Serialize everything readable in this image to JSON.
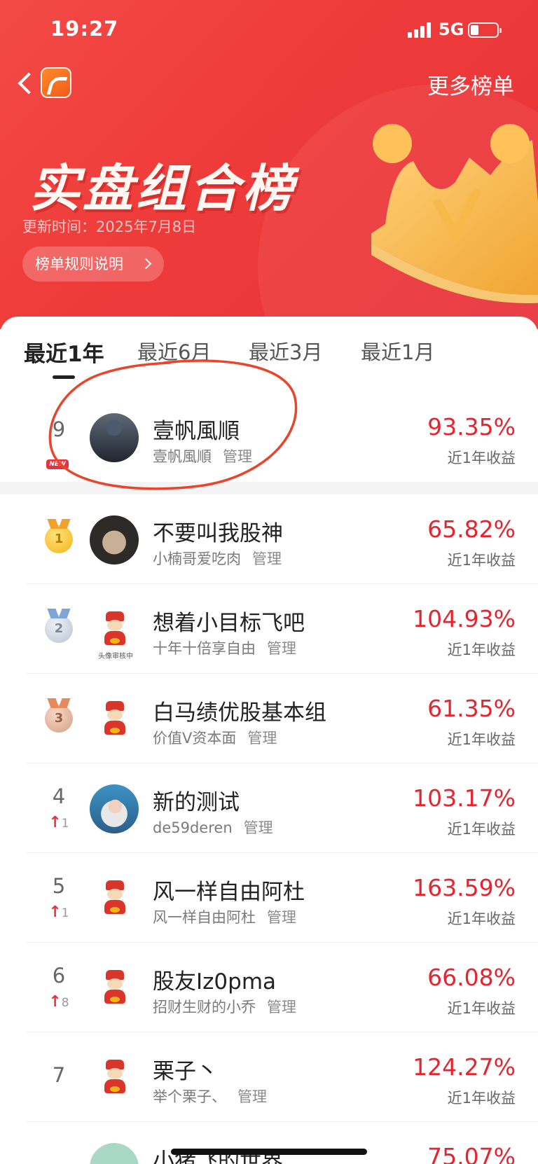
{
  "status": {
    "time": "19:27",
    "network": "5G",
    "battery_level": 0.3
  },
  "header": {
    "more_lists": "更多榜单"
  },
  "hero": {
    "title": "实盘组合榜",
    "update_time": "更新时间：2025年7月8日",
    "rules_button": "榜单规则说明"
  },
  "tabs": [
    {
      "label": "最近1年",
      "active": true
    },
    {
      "label": "最近6月",
      "active": false
    },
    {
      "label": "最近3月",
      "active": false
    },
    {
      "label": "最近1月",
      "active": false
    }
  ],
  "my_entry": {
    "rank": "9",
    "badge": "NEW",
    "name": "壹帆風順",
    "owner": "壹帆風順",
    "manage": "管理",
    "return": "93.35%",
    "return_label": "近1年收益"
  },
  "rankings": [
    {
      "medal": "gold",
      "rank": "1",
      "name": "不要叫我股神",
      "owner": "小楠哥爱吃肉",
      "manage": "管理",
      "return": "65.82%",
      "return_label": "近1年收益"
    },
    {
      "medal": "silver",
      "rank": "2",
      "name": "想着小目标飞吧",
      "owner": "十年十倍享自由",
      "manage": "管理",
      "return": "104.93%",
      "return_label": "近1年收益",
      "avatar_caption": "头像审核中"
    },
    {
      "medal": "bronze",
      "rank": "3",
      "name": "白马绩优股基本组",
      "owner": "价值V资本面",
      "manage": "管理",
      "return": "61.35%",
      "return_label": "近1年收益"
    },
    {
      "rank": "4",
      "change": "1",
      "name": "新的测试",
      "owner": "de59deren",
      "manage": "管理",
      "return": "103.17%",
      "return_label": "近1年收益"
    },
    {
      "rank": "5",
      "change": "1",
      "name": "风一样自由阿杜",
      "owner": "风一样自由阿杜",
      "manage": "管理",
      "return": "163.59%",
      "return_label": "近1年收益"
    },
    {
      "rank": "6",
      "change": "8",
      "name": "股友Iz0pma",
      "owner": "招财生财的小乔",
      "manage": "管理",
      "return": "66.08%",
      "return_label": "近1年收益"
    },
    {
      "rank": "7",
      "name": "栗子丶",
      "owner": "举个栗子、",
      "manage": "管理",
      "return": "124.27%",
      "return_label": "近1年收益"
    },
    {
      "name": "小猪飞的世界",
      "return": "75.07%"
    }
  ],
  "colors": {
    "hero_red": "#ee3b3a",
    "return_red": "#e8232f",
    "annotation": "#e8452c"
  },
  "icons": [
    "back-icon",
    "app-logo-icon",
    "chevron-right-icon",
    "crown-icon",
    "medal-icon",
    "arrow-up-icon"
  ]
}
